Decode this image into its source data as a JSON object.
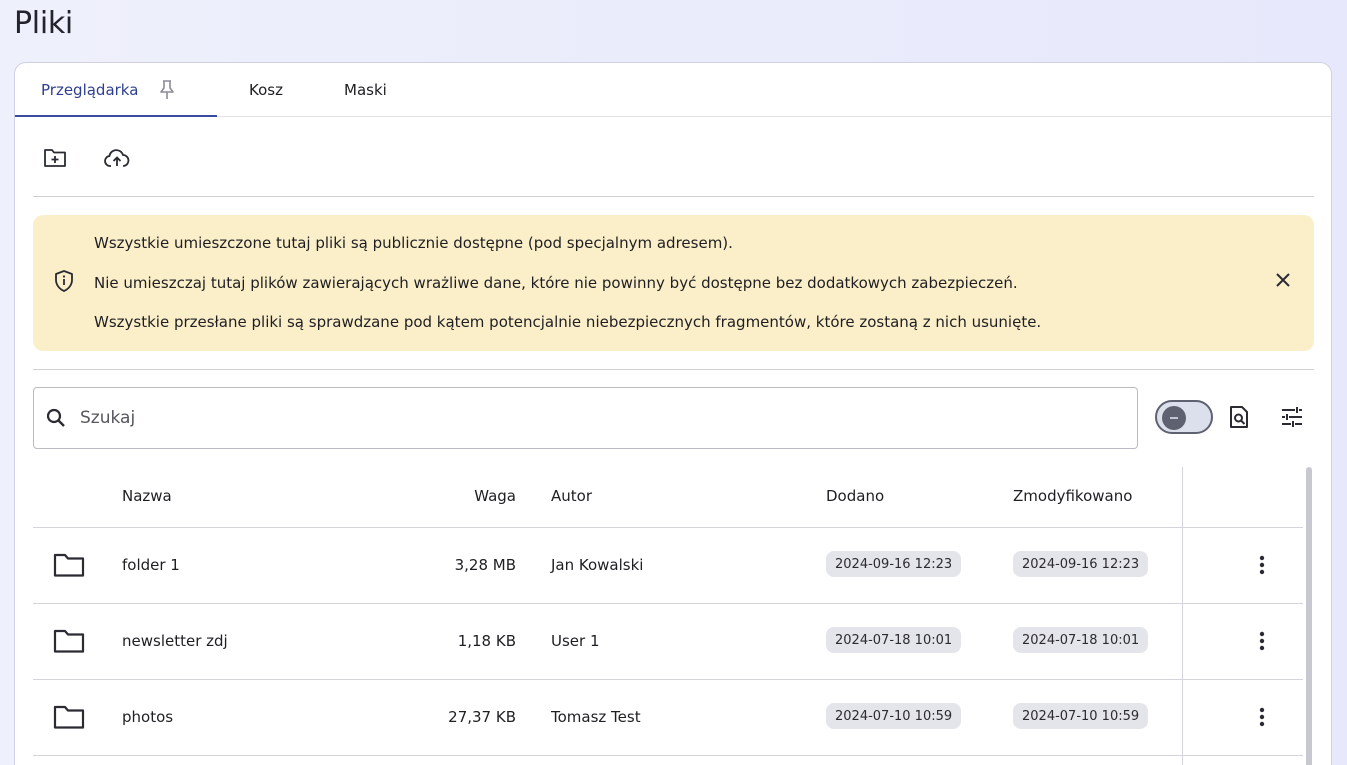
{
  "page": {
    "title": "Pliki"
  },
  "tabs": [
    {
      "label": "Przeglądarka",
      "active": true,
      "pin_icon": "pin-icon"
    },
    {
      "label": "Kosz",
      "active": false
    },
    {
      "label": "Maski",
      "active": false
    }
  ],
  "toolbar": {
    "new_folder_icon": "folder-plus-icon",
    "upload_icon": "cloud-upload-icon"
  },
  "alert": {
    "lines": [
      "Wszystkie umieszczone tutaj pliki są publicznie dostępne (pod specjalnym adresem).",
      "Nie umieszczaj tutaj plików zawierających wrażliwe dane, które nie powinny być dostępne bez dodatkowych zabezpieczeń.",
      "Wszystkie przesłane pliki są sprawdzane pod kątem potencjalnie niebezpiecznych fragmentów, które zostaną z nich usunięte."
    ],
    "background": "#fbefc9"
  },
  "search": {
    "placeholder": "Szukaj",
    "value": ""
  },
  "table": {
    "columns": {
      "name": "Nazwa",
      "size": "Waga",
      "author": "Autor",
      "added": "Dodano",
      "modified": "Zmodyfikowano"
    },
    "rows": [
      {
        "name": "folder 1",
        "size": "3,28 MB",
        "author": "Jan Kowalski",
        "added": "2024-09-16 12:23",
        "modified": "2024-09-16 12:23"
      },
      {
        "name": "newsletter zdj",
        "size": "1,18 KB",
        "author": "User 1",
        "added": "2024-07-18 10:01",
        "modified": "2024-07-18 10:01"
      },
      {
        "name": "photos",
        "size": "27,37 KB",
        "author": "Tomasz Test",
        "added": "2024-07-10 10:59",
        "modified": "2024-07-10 10:59"
      }
    ]
  },
  "colors": {
    "accent": "#3a4aa0",
    "chip": "#e4e5ea"
  }
}
